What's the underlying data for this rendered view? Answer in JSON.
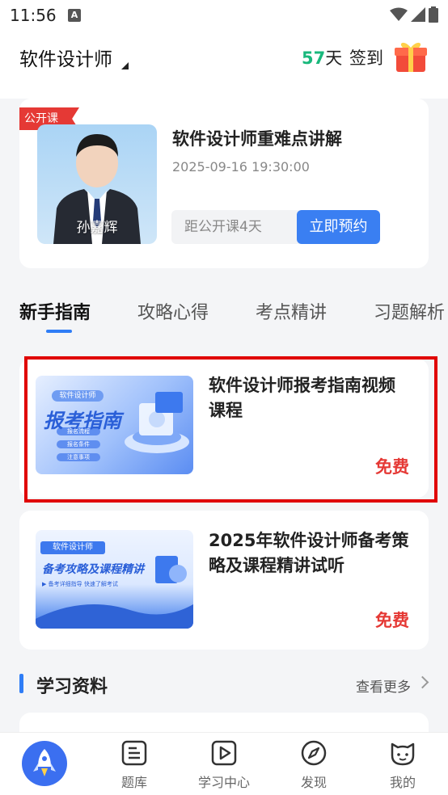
{
  "status_bar": {
    "time": "11:56",
    "notif_icon": "A"
  },
  "header": {
    "title": "软件设计师",
    "streak_number": "57",
    "streak_unit": "天",
    "checkin_label": "签到"
  },
  "live_class": {
    "badge": "公开课",
    "teacher_name": "孙嘉辉",
    "title": "软件设计师重难点讲解",
    "datetime": "2025-09-16 19:30:00",
    "countdown": "距公开课4天",
    "reserve_label": "立即预约"
  },
  "tabs": [
    {
      "label": "新手指南",
      "active": true
    },
    {
      "label": "攻略心得",
      "active": false
    },
    {
      "label": "考点精讲",
      "active": false
    },
    {
      "label": "习题解析",
      "active": false
    }
  ],
  "courses": [
    {
      "thumb_tag": "软件设计师",
      "thumb_heading": "报考指南",
      "thumb_items": [
        "报名流程",
        "报名条件",
        "注意事项"
      ],
      "title": "软件设计师报考指南视频课程",
      "price": "免费"
    },
    {
      "thumb_tag": "软件设计师",
      "thumb_heading": "备考攻略及课程精讲",
      "thumb_sub": "▶ 备考详细指导 快速了解考试",
      "title": "2025年软件设计师备考策略及课程精讲试听",
      "price": "免费"
    }
  ],
  "study_materials": {
    "title": "学习资料",
    "more_label": "查看更多"
  },
  "bottom_nav": [
    {
      "label": "",
      "icon": "rocket-icon"
    },
    {
      "label": "题库",
      "icon": "question-bank-icon"
    },
    {
      "label": "学习中心",
      "icon": "play-icon"
    },
    {
      "label": "发现",
      "icon": "compass-icon"
    },
    {
      "label": "我的",
      "icon": "cat-face-icon"
    }
  ],
  "colors": {
    "accent": "#2f7df6",
    "price_red": "#e53935",
    "streak_green": "#19b87c"
  }
}
